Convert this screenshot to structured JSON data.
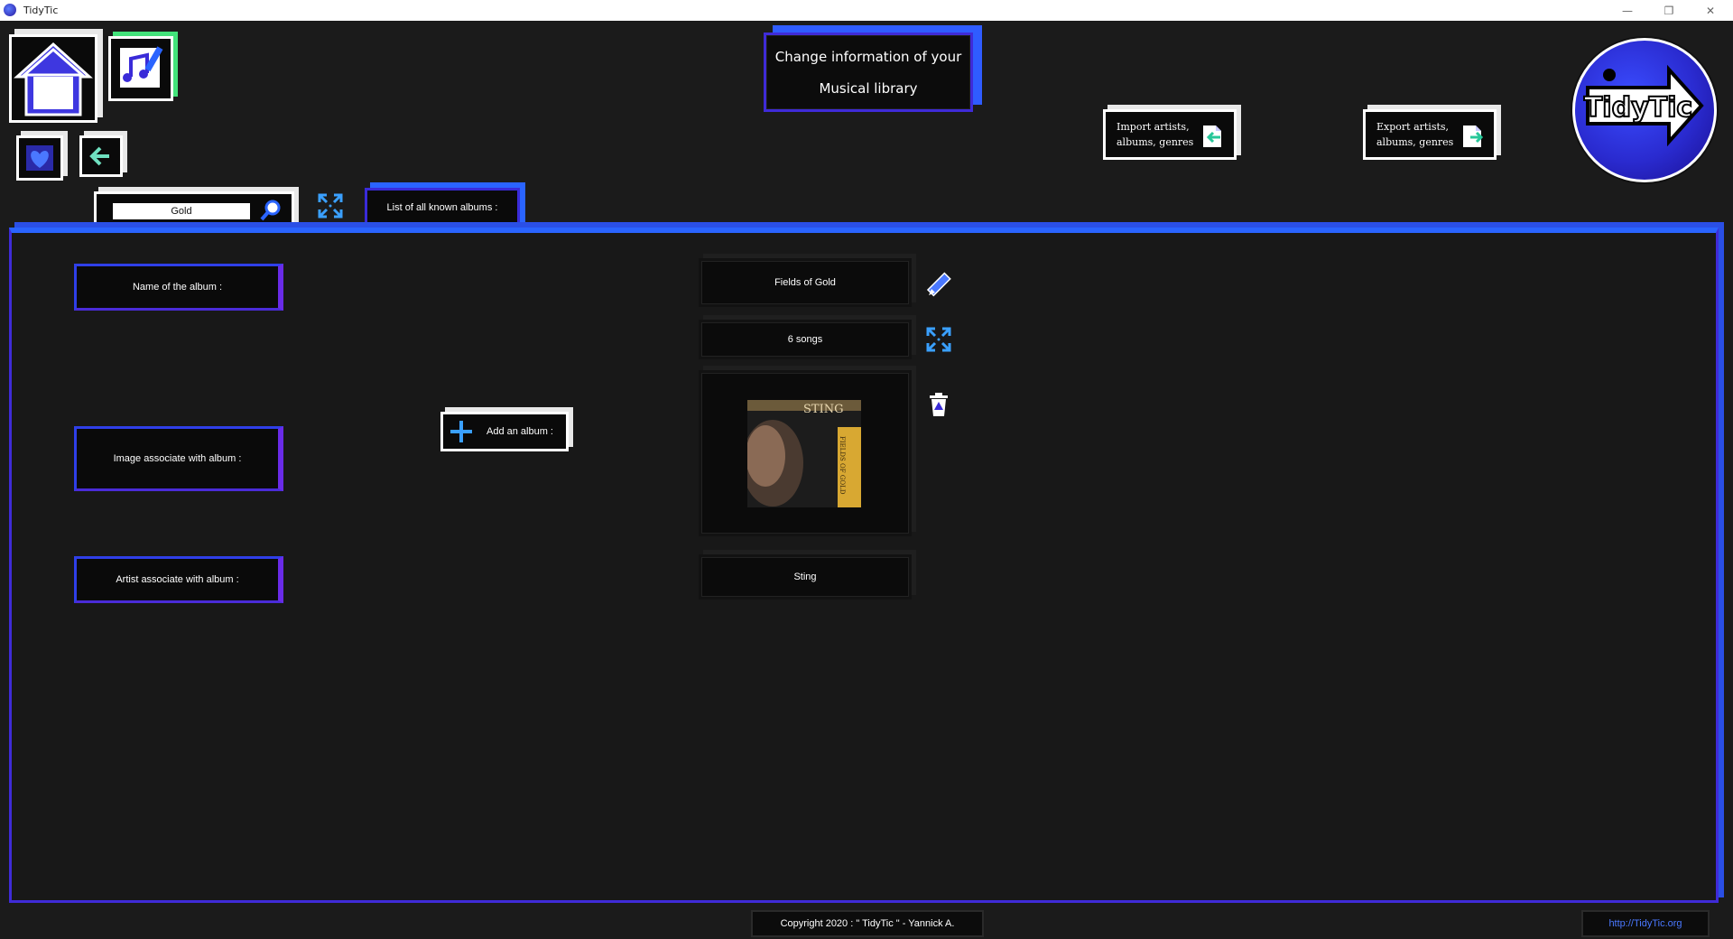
{
  "window": {
    "title": "TidyTic",
    "minimize": "—",
    "restore": "❐",
    "close": "✕"
  },
  "nav": {
    "home_icon": "home-icon",
    "music_icon": "music-edit-icon",
    "favorites_icon": "heart-icon",
    "back_icon": "back-arrow-icon"
  },
  "header": {
    "line1": "Change information of your",
    "line2": "Musical library"
  },
  "import_button": {
    "line1": "Import artists,",
    "line2": "albums, genres"
  },
  "export_button": {
    "line1": "Export artists,",
    "line2": "albums, genres"
  },
  "logo": {
    "text": "TidyTic"
  },
  "search": {
    "value": "Gold"
  },
  "list_tab": {
    "label": "List of all known albums :"
  },
  "fields": {
    "name_label": "Name of the album :",
    "image_label": "Image associate with album :",
    "artist_label": "Artist associate with album :"
  },
  "add_album": {
    "label": "Add an album :"
  },
  "album": {
    "name": "Fields of Gold",
    "songs": "6 songs",
    "artist": "Sting",
    "cover_text": "STING",
    "cover_side_text": "FIELDS OF GOLD"
  },
  "footer": {
    "copyright": "Copyright 2020 : \" TidyTic \" - Yannick A.",
    "link": "http://TidyTic.org"
  },
  "colors": {
    "accent_blue": "#2a64ff",
    "accent_purple": "#6a2be8",
    "background": "#1b1b1b",
    "link": "#4a78ff"
  }
}
